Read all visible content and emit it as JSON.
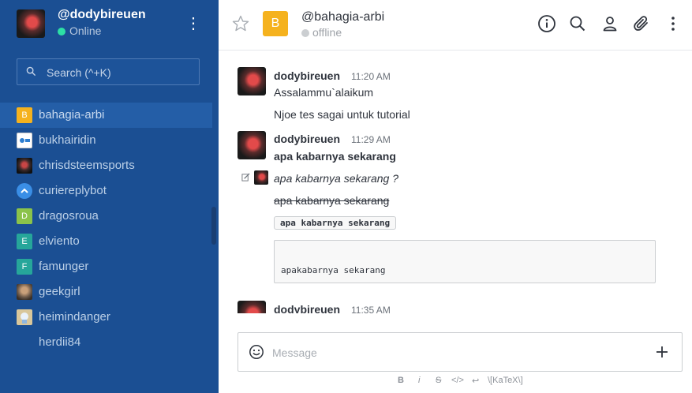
{
  "user": {
    "name": "@dodybireuen",
    "status": "Online"
  },
  "search": {
    "placeholder": "Search (^+K)"
  },
  "rooms": [
    {
      "name": "bahagia-arbi",
      "initial": "B",
      "color": "#f5b21e"
    },
    {
      "name": "bukhairidin",
      "initial": "",
      "color": "#ffffff"
    },
    {
      "name": "chrisdsteemsports",
      "initial": "",
      "color": "#333333"
    },
    {
      "name": "curiereplybot",
      "initial": "",
      "color": "#3a8ee6"
    },
    {
      "name": "dragosroua",
      "initial": "D",
      "color": "#8bc34a"
    },
    {
      "name": "elviento",
      "initial": "E",
      "color": "#26a69a"
    },
    {
      "name": "famunger",
      "initial": "F",
      "color": "#26a69a"
    },
    {
      "name": "geekgirl",
      "initial": "",
      "color": "#6d5a4a"
    },
    {
      "name": "heimindanger",
      "initial": "",
      "color": "#d9c79b"
    },
    {
      "name": "herdii84",
      "initial": "",
      "color": ""
    }
  ],
  "room": {
    "title": "@bahagia-arbi",
    "status": "offline",
    "initial": "B"
  },
  "messages": [
    {
      "user": "dodybireuen",
      "time": "11:20 AM",
      "lines": [
        "Assalammu`alaikum",
        "Njoe tes sagai untuk tutorial"
      ]
    },
    {
      "user": "dodybireuen",
      "time": "11:29 AM",
      "bold": "apa kabarnya sekarang",
      "italic": "apa kabarnya sekarang ?",
      "strike": "apa kabarnya sekarang",
      "inline_code": "apa kabarnya sekarang",
      "code_block": "apakabarnya sekarang"
    },
    {
      "user": "dodybireuen",
      "time": "11:35 AM"
    }
  ],
  "composer": {
    "placeholder": "Message"
  },
  "format": {
    "bold": "B",
    "italic": "i",
    "strike": "S",
    "code": "</>",
    "katex": "\\[KaTeX\\]"
  }
}
